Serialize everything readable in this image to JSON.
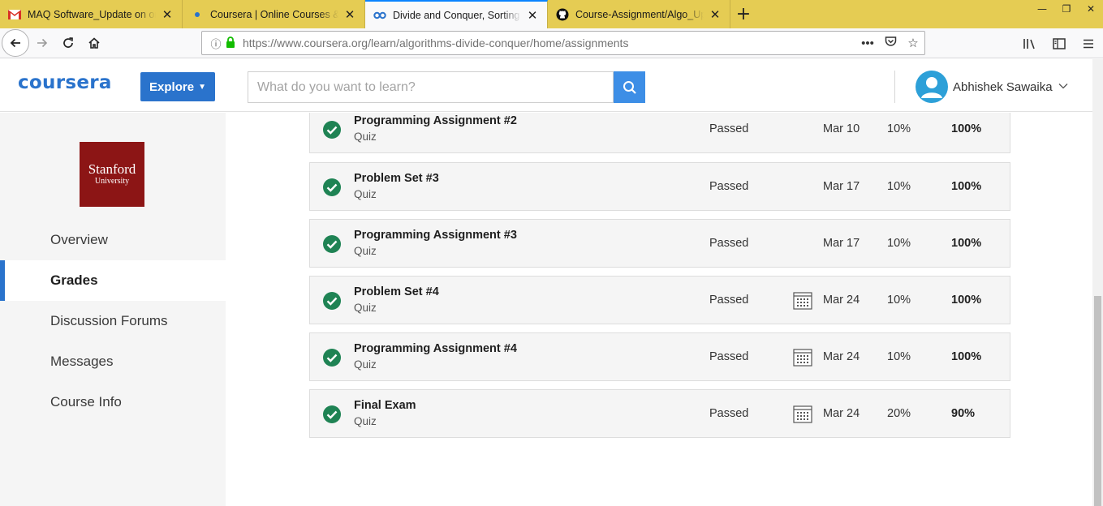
{
  "browser": {
    "tabs": [
      {
        "title": "MAQ Software_Update on online",
        "favicon": "gmail-icon"
      },
      {
        "title": "Coursera | Online Courses & Credentials",
        "favicon": "dot-icon"
      },
      {
        "title": "Divide and Conquer, Sorting and Searching",
        "favicon": "coursera-icon",
        "active": true
      },
      {
        "title": "Course-Assignment/Algo_Update",
        "favicon": "github-icon"
      }
    ],
    "url_host": "https://www.coursera.org",
    "url_path": "/learn/algorithms-divide-conquer/home/assignments"
  },
  "header": {
    "logo": "coursera",
    "explore_label": "Explore",
    "search_placeholder": "What do you want to learn?",
    "user_name": "Abhishek Sawaika"
  },
  "sidebar": {
    "university_line1": "Stanford",
    "university_line2": "University",
    "items": [
      {
        "label": "Overview"
      },
      {
        "label": "Grades",
        "active": true
      },
      {
        "label": "Discussion Forums"
      },
      {
        "label": "Messages"
      },
      {
        "label": "Course Info"
      }
    ]
  },
  "assignments": [
    {
      "name": "Programming Assignment #2",
      "type": "Quiz",
      "status": "Passed",
      "due": "Mar 10",
      "weight": "10%",
      "grade": "100%",
      "calendar": false
    },
    {
      "name": "Problem Set #3",
      "type": "Quiz",
      "status": "Passed",
      "due": "Mar 17",
      "weight": "10%",
      "grade": "100%",
      "calendar": false
    },
    {
      "name": "Programming Assignment #3",
      "type": "Quiz",
      "status": "Passed",
      "due": "Mar 17",
      "weight": "10%",
      "grade": "100%",
      "calendar": false
    },
    {
      "name": "Problem Set #4",
      "type": "Quiz",
      "status": "Passed",
      "due": "Mar 24",
      "weight": "10%",
      "grade": "100%",
      "calendar": true
    },
    {
      "name": "Programming Assignment #4",
      "type": "Quiz",
      "status": "Passed",
      "due": "Mar 24",
      "weight": "10%",
      "grade": "100%",
      "calendar": true
    },
    {
      "name": "Final Exam",
      "type": "Quiz",
      "status": "Passed",
      "due": "Mar 24",
      "weight": "20%",
      "grade": "90%",
      "calendar": true
    }
  ],
  "colors": {
    "brand_blue": "#2a73cc",
    "check_green": "#1f8354",
    "stanford_red": "#8c1515",
    "tabstrip_yellow": "#e5cc53"
  }
}
